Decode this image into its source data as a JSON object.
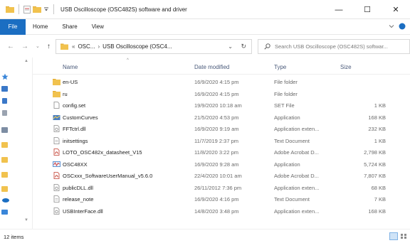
{
  "window": {
    "title": "USB Oscilloscope (OSC482S) software and driver",
    "minimize_glyph": "—",
    "maximize_glyph": "☐",
    "close_glyph": "✕"
  },
  "ribbon": {
    "tabs": [
      "File",
      "Home",
      "Share",
      "View"
    ]
  },
  "address": {
    "prefix": "«",
    "crumbs": [
      "OSC...",
      "USB Oscilloscope (OSC4..."
    ],
    "separator": "›"
  },
  "search": {
    "placeholder": "Search USB Oscilloscope (OSC482S) softwar..."
  },
  "columns": {
    "name": "Name",
    "date": "Date modified",
    "type": "Type",
    "size": "Size"
  },
  "files": [
    {
      "name": "en-US",
      "date": "16/9/2020 4:15 pm",
      "type": "File folder",
      "size": "",
      "icon": "folder-icon"
    },
    {
      "name": "ru",
      "date": "16/9/2020 4:15 pm",
      "type": "File folder",
      "size": "",
      "icon": "folder-icon"
    },
    {
      "name": "config.set",
      "date": "19/9/2020 10:18 am",
      "type": "SET File",
      "size": "1 KB",
      "icon": "file-icon"
    },
    {
      "name": "CustomCurves",
      "date": "21/5/2020 4:53 pm",
      "type": "Application",
      "size": "168 KB",
      "icon": "app-curves-icon"
    },
    {
      "name": "FFTctrl.dll",
      "date": "16/9/2020 9:19 am",
      "type": "Application exten...",
      "size": "232 KB",
      "icon": "dll-icon"
    },
    {
      "name": "initsettings",
      "date": "11/7/2019 2:37 pm",
      "type": "Text Document",
      "size": "1 KB",
      "icon": "text-file-icon"
    },
    {
      "name": "LOTO_OSC482x_datasheet_V15",
      "date": "11/8/2020 3:22 pm",
      "type": "Adobe Acrobat D...",
      "size": "2,798 KB",
      "icon": "pdf-icon"
    },
    {
      "name": "OSC48XX",
      "date": "16/9/2020 9:28 am",
      "type": "Application",
      "size": "5,724 KB",
      "icon": "app-osc-icon"
    },
    {
      "name": "OSCxxx_SoftwareUserManual_v5.6.0",
      "date": "22/4/2020 10:01 am",
      "type": "Adobe Acrobat D...",
      "size": "7,807 KB",
      "icon": "pdf-icon"
    },
    {
      "name": "publicDLL.dll",
      "date": "26/11/2012 7:36 pm",
      "type": "Application exten...",
      "size": "68 KB",
      "icon": "dll-icon"
    },
    {
      "name": "release_note",
      "date": "16/9/2020 4:16 pm",
      "type": "Text Document",
      "size": "7 KB",
      "icon": "text-file-icon"
    },
    {
      "name": "USBInterFace.dll",
      "date": "14/8/2020 3:48 pm",
      "type": "Application exten...",
      "size": "168 KB",
      "icon": "dll-icon"
    }
  ],
  "status": {
    "item_count": "12 items"
  },
  "colors": {
    "accent": "#1b6ec2",
    "folder": "#e8b94a",
    "pdf": "#c0392b"
  }
}
